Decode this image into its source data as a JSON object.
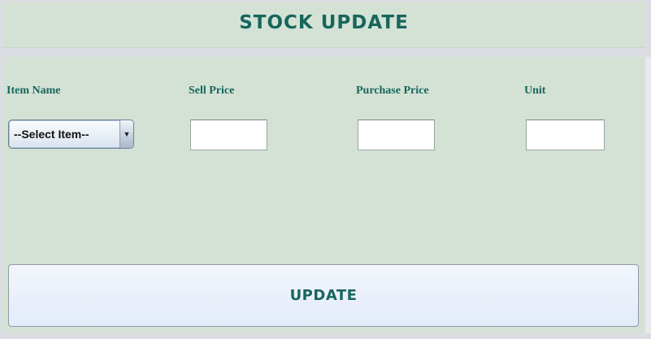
{
  "header": {
    "title": "STOCK UPDATE"
  },
  "form": {
    "labels": {
      "item_name": "Item Name",
      "sell_price": "Sell Price",
      "purchase_price": "Purchase Price",
      "unit": "Unit"
    },
    "item_select": {
      "selected": "--Select Item--",
      "arrow_icon": "triangle-down"
    },
    "sell_price_value": "",
    "purchase_price_value": "",
    "unit_value": ""
  },
  "actions": {
    "update_label": "UPDATE"
  },
  "colors": {
    "panel_bg": "#d4e2d6",
    "accent_text": "#17665c",
    "window_bg": "#dcdde2"
  }
}
